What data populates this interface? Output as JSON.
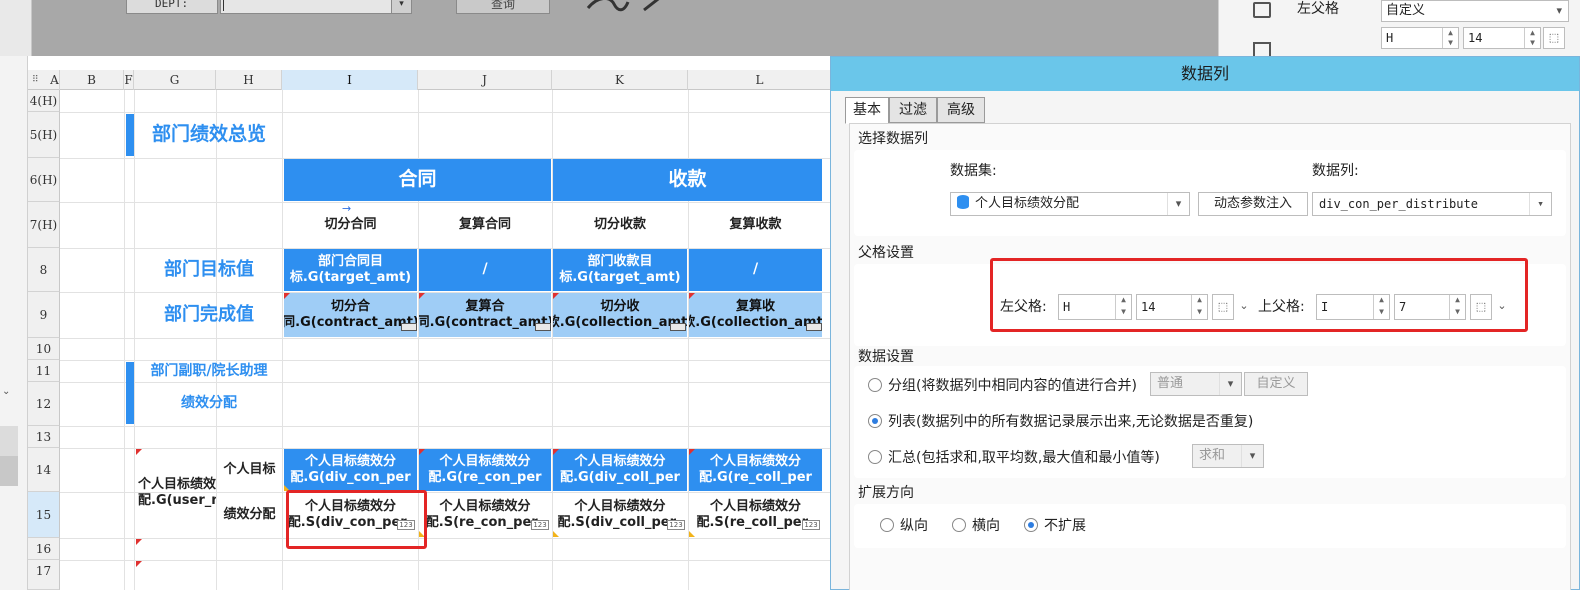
{
  "params": {
    "dept_label": "DEPT:",
    "query_label": "查询"
  },
  "prop": {
    "parent_label": "左父格",
    "parent_value": "自定义",
    "col": "H",
    "row": "14"
  },
  "sheet": {
    "columns": [
      "A",
      "B",
      "F",
      "G",
      "H",
      "I",
      "J",
      "K",
      "L"
    ],
    "rows": [
      "4(H)",
      "5(H)",
      "6(H)",
      "7(H)",
      "8",
      "9",
      "10",
      "11",
      "12",
      "13",
      "14",
      "15",
      "16",
      "17"
    ],
    "overview_title": "部门绩效总览",
    "contract_header": "合同",
    "collection_header": "收款",
    "sub_headers": [
      "切分合同",
      "复算合同",
      "切分收款",
      "复算收款"
    ],
    "target_label": "部门目标值",
    "done_label": "部门完成值",
    "target_cells": [
      "部门合同目标.G(target_amt)",
      "/",
      "部门收款目标.G(target_amt)",
      "/"
    ],
    "done_cells": [
      "切分合同.G(contract_amt)",
      "复算合同.G(contract_amt)",
      "切分收款.G(collection_amt)",
      "复算收款.G(collection_amt)"
    ],
    "assist_title_1": "部门副职/院长助理",
    "assist_title_2": "绩效分配",
    "user_cell": "个人目标绩效分配.G(user_name)",
    "h14": "个人目标",
    "h15": "绩效分配",
    "row14_cells": [
      "个人目标绩效分配.G(div_con_per",
      "个人目标绩效分配.G(re_con_per",
      "个人目标绩效分配.G(div_coll_per",
      "个人目标绩效分配.G(re_coll_per"
    ],
    "row15_cells": [
      "个人目标绩效分配.S(div_con_per_",
      "个人目标绩效分配.S(re_con_per_",
      "个人目标绩效分配.S(div_coll_per_",
      "个人目标绩效分配.S(re_coll_per_"
    ],
    "tag": "123"
  },
  "dialog": {
    "title": "数据列",
    "tabs": [
      "基本",
      "过滤",
      "高级"
    ],
    "select_section": "选择数据列",
    "dataset_label": "数据集:",
    "dataset_value": "个人目标绩效分配",
    "inject_button": "动态参数注入",
    "column_label": "数据列:",
    "column_value": "div_con_per_distribute",
    "parent_section": "父格设置",
    "left_parent_label": "左父格:",
    "left_parent_col": "H",
    "left_parent_row": "14",
    "top_parent_label": "上父格:",
    "top_parent_col": "I",
    "top_parent_row": "7",
    "data_section": "数据设置",
    "group_label": "分组(将数据列中相同内容的值进行合并)",
    "group_mode": "普通",
    "group_custom": "自定义",
    "list_label": "列表(数据列中的所有数据记录展示出来,无论数据是否重复)",
    "summary_label": "汇总(包括求和,取平均数,最大值和最小值等)",
    "summary_mode": "求和",
    "expand_section": "扩展方向",
    "expand_options": [
      "纵向",
      "横向",
      "不扩展"
    ],
    "selected_data_setting": "list",
    "selected_expand": "不扩展"
  },
  "colors": {
    "accent": "#2e8ff0",
    "light_accent": "#9fcdf6",
    "highlight": "#e32525",
    "dialog_title": "#6ac6ea"
  }
}
